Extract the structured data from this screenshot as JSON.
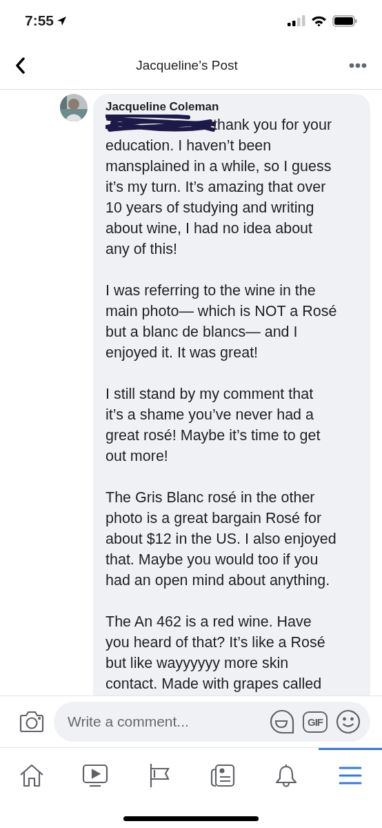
{
  "status_bar": {
    "time": "7:55"
  },
  "header": {
    "title": "Jacqueline’s Post"
  },
  "comment": {
    "author": "Jacqueline Coleman",
    "redacted_mention": true,
    "paragraphs": [
      "thank you for your\neducation. I haven’t been\nmansplained in a while, so I guess\nit’s my turn. It’s amazing  that over\n10 years of studying and writing\nabout wine, I had no idea about\nany of this!",
      "I was referring to the wine in the\nmain photo— which is NOT a Rosé\nbut a blanc de blancs— and I\nenjoyed it. It was great!",
      "I still stand by my comment that\nit’s a shame you’ve never had a\ngreat rosé! Maybe it’s time to get\nout more!",
      "The Gris Blanc rosé in the other\nphoto is a great bargain Rosé for\nabout $12 in the US. I also enjoyed\nthat. Maybe you would too if you\nhad an open mind about anything.",
      "The An 462 is a red wine. Have\nyou heard of that? It’s like a Rosé\nbut like wayyyyyy more skin\ncontact. Made with grapes called"
    ]
  },
  "composer": {
    "placeholder": "Write a comment...",
    "gif_label": "GIF"
  },
  "nav": [
    {
      "kind": "home",
      "selected": false
    },
    {
      "kind": "video",
      "selected": false
    },
    {
      "kind": "pages",
      "selected": false
    },
    {
      "kind": "news",
      "selected": false
    },
    {
      "kind": "bell",
      "selected": false
    },
    {
      "kind": "menu",
      "selected": true
    }
  ]
}
